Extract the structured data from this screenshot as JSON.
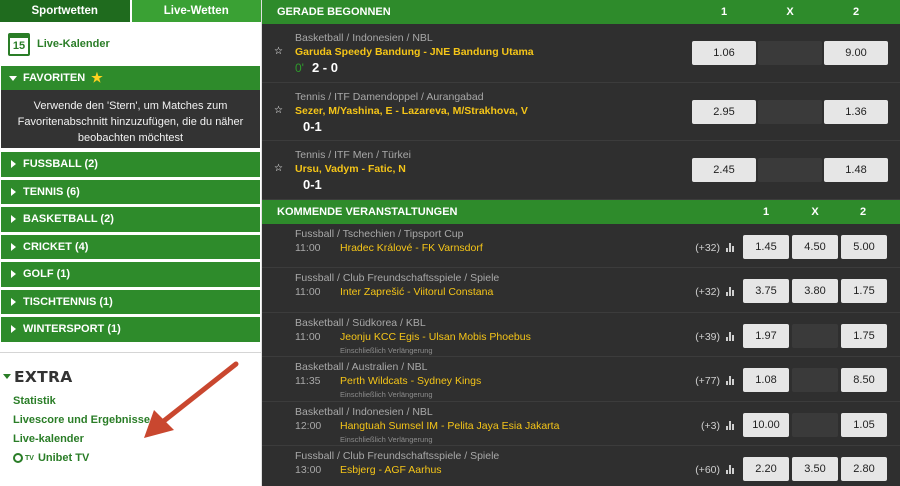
{
  "tabs": {
    "sport": "Sportwetten",
    "live": "Live-Wetten"
  },
  "live_calendar": {
    "day": "15",
    "label": "Live-Kalender"
  },
  "favorites": {
    "title": "FAVORITEN",
    "text": "Verwende den 'Stern', um Matches zum Favoritenabschnitt hinzuzufügen, die du näher beobachten möchtest"
  },
  "sports": [
    {
      "label": "FUSSBALL (2)"
    },
    {
      "label": "TENNIS (6)"
    },
    {
      "label": "BASKETBALL (2)"
    },
    {
      "label": "CRICKET (4)"
    },
    {
      "label": "GOLF (1)"
    },
    {
      "label": "TISCHTENNIS (1)"
    },
    {
      "label": "WINTERSPORT (1)"
    }
  ],
  "extra": {
    "title": "EXTRA",
    "links": [
      "Statistik",
      "Livescore und Ergebnisse",
      "Live-kalender",
      "Unibet TV"
    ],
    "tv_badge": "TV"
  },
  "live_section": {
    "title": "GERADE BEGONNEN",
    "cols": [
      "1",
      "X",
      "2"
    ],
    "rows": [
      {
        "crumb": "Basketball  /  Indonesien  /  NBL",
        "match": "Garuda Speedy Bandung - JNE Bandung Utama",
        "minute": "0'",
        "score": "2 - 0",
        "odd1": "1.06",
        "odd2": "9.00"
      },
      {
        "crumb": "Tennis  /  ITF Damendoppel  /  Aurangabad",
        "match": "Sezer, M/Yashina, E - Lazareva, M/Strakhova, V",
        "minute": "",
        "score": "0-1",
        "odd1": "2.95",
        "odd2": "1.36"
      },
      {
        "crumb": "Tennis  /  ITF Men  /  Türkei",
        "match": "Ursu, Vadym - Fatic, N",
        "minute": "",
        "score": "0-1",
        "odd1": "2.45",
        "odd2": "1.48"
      }
    ]
  },
  "upcoming_section": {
    "title": "KOMMENDE VERANSTALTUNGEN",
    "cols": [
      "1",
      "X",
      "2"
    ],
    "rows": [
      {
        "crumb": "Fussball  /  Tschechien  /  Tipsport Cup",
        "time": "11:00",
        "match": "Hradec Králové  -  FK Varnsdorf",
        "note": "",
        "more": "(+32)",
        "odd1": "1.45",
        "oddx": "4.50",
        "odd2": "5.00"
      },
      {
        "crumb": "Fussball  /  Club Freundschaftsspiele  /  Spiele",
        "time": "11:00",
        "match": "Inter Zaprešić  -  Viitorul Constana",
        "note": "",
        "more": "(+32)",
        "odd1": "3.75",
        "oddx": "3.80",
        "odd2": "1.75"
      },
      {
        "crumb": "Basketball  /  Südkorea  /  KBL",
        "time": "11:00",
        "match": "Jeonju KCC Egis  -  Ulsan Mobis Phoebus",
        "note": "Einschließlich Verlängerung",
        "more": "(+39)",
        "odd1": "1.97",
        "oddx": "",
        "odd2": "1.75"
      },
      {
        "crumb": "Basketball  /  Australien  /  NBL",
        "time": "11:35",
        "match": "Perth Wildcats  -  Sydney Kings",
        "note": "Einschließlich Verlängerung",
        "more": "(+77)",
        "odd1": "1.08",
        "oddx": "",
        "odd2": "8.50"
      },
      {
        "crumb": "Basketball  /  Indonesien  /  NBL",
        "time": "12:00",
        "match": "Hangtuah Sumsel IM  -  Pelita Jaya Esia Jakarta",
        "note": "Einschließlich Verlängerung",
        "more": "(+3)",
        "odd1": "10.00",
        "oddx": "",
        "odd2": "1.05"
      },
      {
        "crumb": "Fussball  /  Club Freundschaftsspiele  /  Spiele",
        "time": "13:00",
        "match": "Esbjerg  -  AGF Aarhus",
        "note": "",
        "more": "(+60)",
        "odd1": "2.20",
        "oddx": "3.50",
        "odd2": "2.80"
      }
    ]
  },
  "colors": {
    "green": "#2e8b2b",
    "dark_green": "#1f6b1e",
    "light_green": "#3aa134",
    "gold": "#f5c518",
    "arrow": "#c9472f"
  }
}
